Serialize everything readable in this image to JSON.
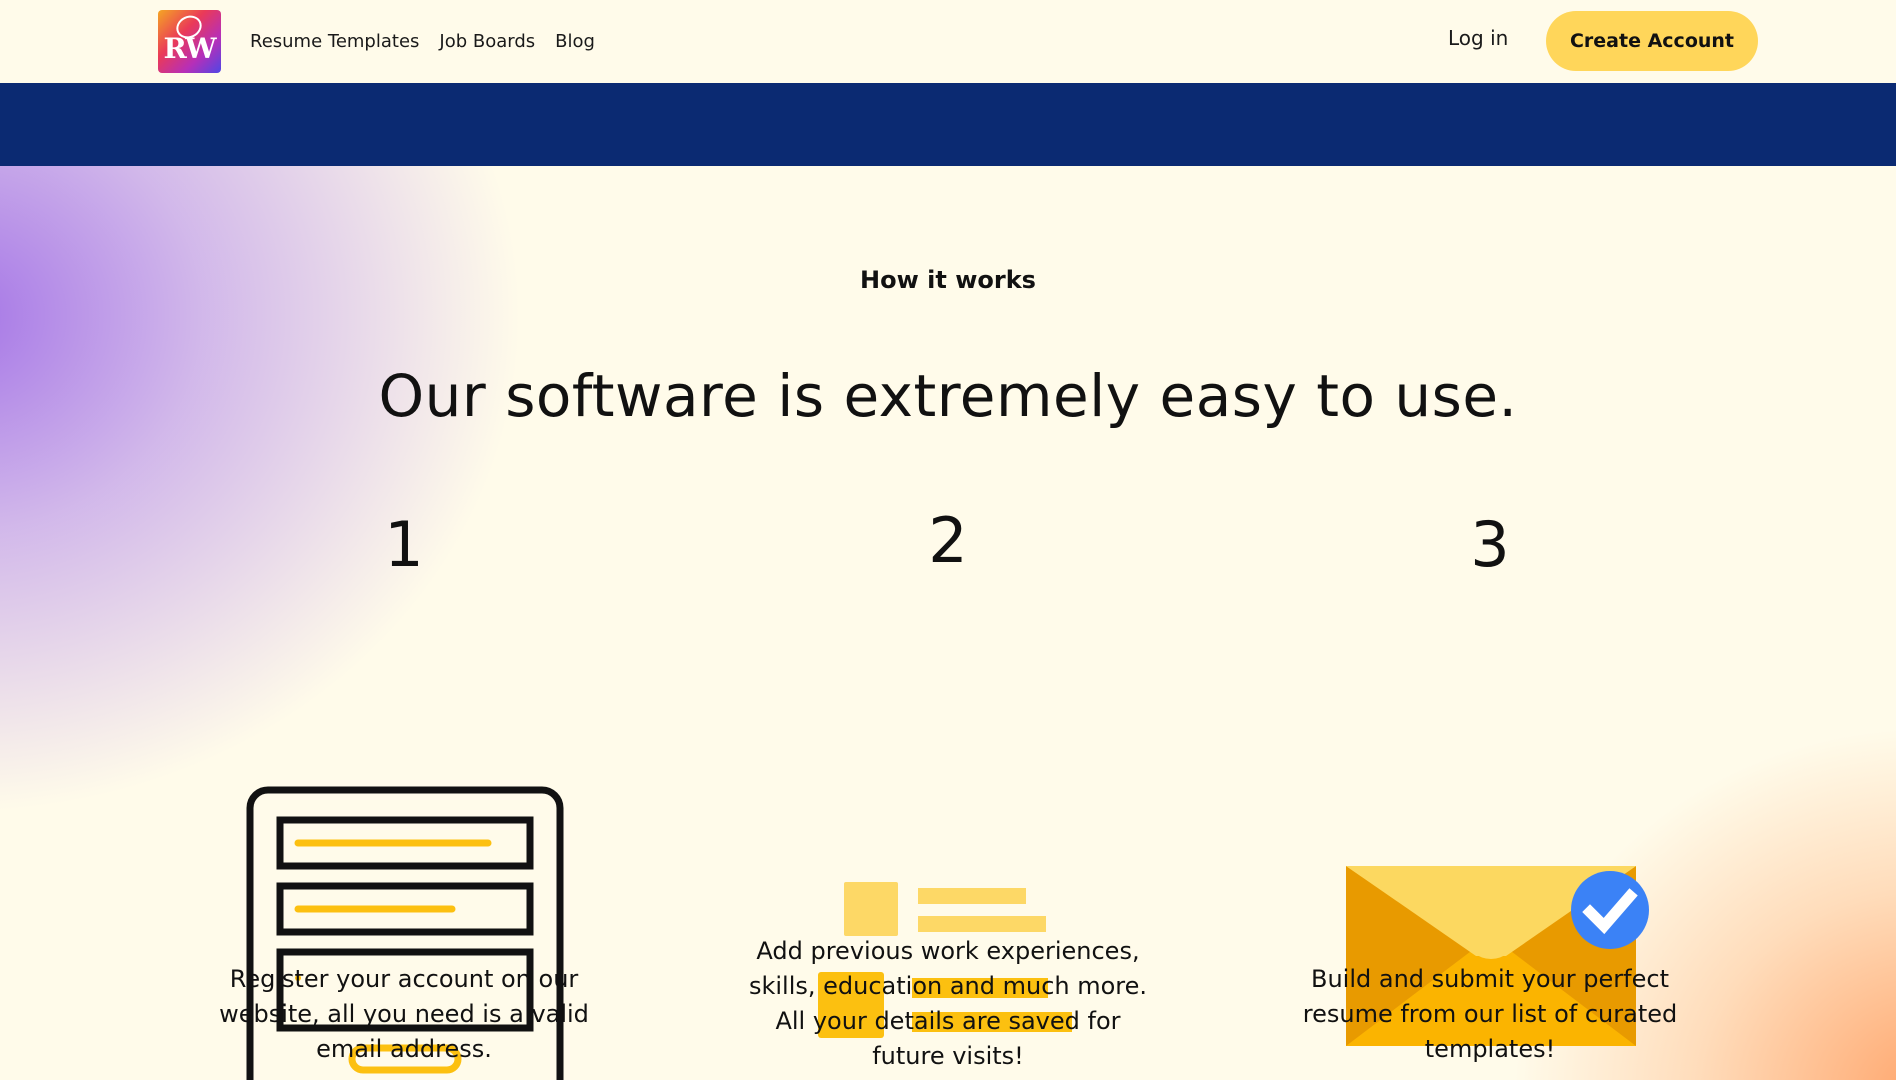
{
  "header": {
    "logo_text": "RW",
    "nav": [
      {
        "label": "Resume Templates"
      },
      {
        "label": "Job Boards"
      },
      {
        "label": "Blog"
      }
    ],
    "login_label": "Log in",
    "create_account_label": "Create Account"
  },
  "how_it_works": {
    "eyebrow": "How it works",
    "headline": "Our software is extremely easy to use.",
    "steps": [
      {
        "number": "1",
        "description": "Register your account on our website, all you need is a valid email address.",
        "icon": "form-icon"
      },
      {
        "number": "2",
        "description": "Add previous work experiences, skills, education and much more. All your details are saved for future visits!",
        "icon": "details-list-icon"
      },
      {
        "number": "3",
        "description": "Build and submit your perfect resume from our list of curated templates!",
        "icon": "envelope-check-icon"
      }
    ]
  },
  "colors": {
    "background": "#fffbea",
    "banner": "#0b2a72",
    "accent_yellow": "#ffd65a",
    "icon_yellow": "#fcc010",
    "check_blue": "#3b82f6"
  }
}
